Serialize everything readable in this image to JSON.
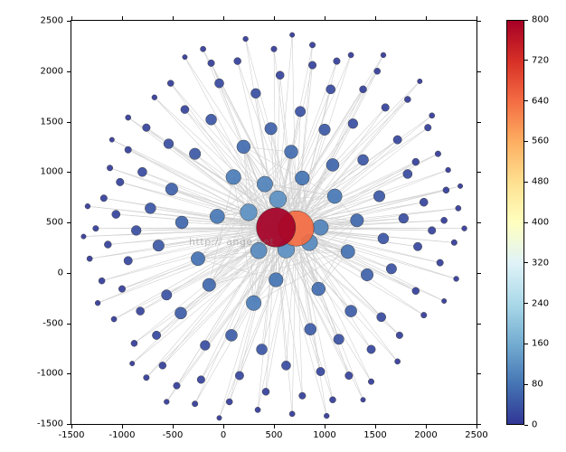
{
  "chart_data": {
    "type": "scatter",
    "title": "",
    "xlabel": "",
    "ylabel": "",
    "xlim": [
      -1500,
      2500
    ],
    "ylim": [
      -1500,
      2500
    ],
    "xticks": [
      -1500,
      -1000,
      -500,
      0,
      500,
      1000,
      1500,
      2000,
      2500
    ],
    "yticks": [
      -1500,
      -1000,
      -500,
      0,
      500,
      1000,
      1500,
      2000,
      2500
    ],
    "colorbar": {
      "ticks": [
        0,
        80,
        160,
        240,
        320,
        400,
        480,
        560,
        640,
        720,
        800
      ],
      "range": [
        0,
        800
      ],
      "cmap": "RdYlBu_r"
    },
    "description": "Network graph with edges between nodes. Node size and color scale with value (0–800). Two central hubs (~500,450 value≈800 red; ~700,450 value≈640 orange), surrounded by mid-size blue nodes and many small peripheral points.",
    "nodes": [
      {
        "x": 520,
        "y": 450,
        "v": 800
      },
      {
        "x": 720,
        "y": 440,
        "v": 640
      },
      {
        "x": 250,
        "y": 600,
        "v": 120
      },
      {
        "x": 620,
        "y": 230,
        "v": 120
      },
      {
        "x": 540,
        "y": 730,
        "v": 120
      },
      {
        "x": 350,
        "y": 220,
        "v": 110
      },
      {
        "x": 850,
        "y": 300,
        "v": 110
      },
      {
        "x": 410,
        "y": 880,
        "v": 100
      },
      {
        "x": 960,
        "y": 450,
        "v": 100
      },
      {
        "x": 300,
        "y": -300,
        "v": 90
      },
      {
        "x": 100,
        "y": 950,
        "v": 90
      },
      {
        "x": 1100,
        "y": 760,
        "v": 85
      },
      {
        "x": -60,
        "y": 560,
        "v": 85
      },
      {
        "x": 780,
        "y": 940,
        "v": 80
      },
      {
        "x": 520,
        "y": -70,
        "v": 80
      },
      {
        "x": -250,
        "y": 140,
        "v": 75
      },
      {
        "x": 1230,
        "y": 210,
        "v": 75
      },
      {
        "x": 940,
        "y": -160,
        "v": 70
      },
      {
        "x": 200,
        "y": 1250,
        "v": 70
      },
      {
        "x": 670,
        "y": 1200,
        "v": 70
      },
      {
        "x": -140,
        "y": -120,
        "v": 65
      },
      {
        "x": 1320,
        "y": 520,
        "v": 65
      },
      {
        "x": -410,
        "y": 500,
        "v": 60
      },
      {
        "x": 1080,
        "y": 1070,
        "v": 60
      },
      {
        "x": 470,
        "y": 1430,
        "v": 55
      },
      {
        "x": -510,
        "y": 830,
        "v": 55
      },
      {
        "x": 1420,
        "y": -20,
        "v": 55
      },
      {
        "x": -420,
        "y": -400,
        "v": 50
      },
      {
        "x": 1260,
        "y": -380,
        "v": 50
      },
      {
        "x": 80,
        "y": -620,
        "v": 50
      },
      {
        "x": 860,
        "y": -560,
        "v": 50
      },
      {
        "x": 1540,
        "y": 760,
        "v": 45
      },
      {
        "x": -640,
        "y": 270,
        "v": 45
      },
      {
        "x": 1000,
        "y": 1420,
        "v": 45
      },
      {
        "x": -280,
        "y": 1180,
        "v": 45
      },
      {
        "x": 1580,
        "y": 340,
        "v": 40
      },
      {
        "x": 380,
        "y": -760,
        "v": 40
      },
      {
        "x": -720,
        "y": 640,
        "v": 40
      },
      {
        "x": 1380,
        "y": 1120,
        "v": 40
      },
      {
        "x": -120,
        "y": 1520,
        "v": 40
      },
      {
        "x": 760,
        "y": 1600,
        "v": 35
      },
      {
        "x": 1660,
        "y": 40,
        "v": 35
      },
      {
        "x": -560,
        "y": -220,
        "v": 35
      },
      {
        "x": 1140,
        "y": -660,
        "v": 35
      },
      {
        "x": -180,
        "y": -720,
        "v": 30
      },
      {
        "x": 1780,
        "y": 540,
        "v": 30
      },
      {
        "x": -860,
        "y": 420,
        "v": 30
      },
      {
        "x": 320,
        "y": 1780,
        "v": 30
      },
      {
        "x": 1280,
        "y": 1480,
        "v": 30
      },
      {
        "x": -540,
        "y": 1280,
        "v": 30
      },
      {
        "x": 1560,
        "y": -440,
        "v": 25
      },
      {
        "x": 620,
        "y": -920,
        "v": 25
      },
      {
        "x": -800,
        "y": 1000,
        "v": 25
      },
      {
        "x": 1820,
        "y": 980,
        "v": 25
      },
      {
        "x": -40,
        "y": 1880,
        "v": 25
      },
      {
        "x": 1060,
        "y": 1820,
        "v": 25
      },
      {
        "x": -940,
        "y": 120,
        "v": 20
      },
      {
        "x": 1920,
        "y": 260,
        "v": 20
      },
      {
        "x": -660,
        "y": -620,
        "v": 20
      },
      {
        "x": 1460,
        "y": -760,
        "v": 20
      },
      {
        "x": 160,
        "y": -1020,
        "v": 20
      },
      {
        "x": 960,
        "y": -980,
        "v": 20
      },
      {
        "x": 1720,
        "y": 1320,
        "v": 20
      },
      {
        "x": -820,
        "y": -380,
        "v": 18
      },
      {
        "x": -380,
        "y": 1620,
        "v": 18
      },
      {
        "x": 1980,
        "y": 700,
        "v": 18
      },
      {
        "x": -1060,
        "y": 580,
        "v": 18
      },
      {
        "x": 560,
        "y": 1960,
        "v": 18
      },
      {
        "x": 1600,
        "y": 1640,
        "v": 15
      },
      {
        "x": -220,
        "y": -1060,
        "v": 15
      },
      {
        "x": 1240,
        "y": -1020,
        "v": 15
      },
      {
        "x": -1020,
        "y": 900,
        "v": 15
      },
      {
        "x": 2060,
        "y": 420,
        "v": 15
      },
      {
        "x": 880,
        "y": 2060,
        "v": 15
      },
      {
        "x": -760,
        "y": 1440,
        "v": 15
      },
      {
        "x": 1900,
        "y": -180,
        "v": 12
      },
      {
        "x": -1140,
        "y": 280,
        "v": 12
      },
      {
        "x": 420,
        "y": -1180,
        "v": 12
      },
      {
        "x": 1900,
        "y": 1100,
        "v": 12
      },
      {
        "x": -600,
        "y": -920,
        "v": 12
      },
      {
        "x": 1380,
        "y": 1820,
        "v": 12
      },
      {
        "x": 140,
        "y": 2100,
        "v": 12
      },
      {
        "x": -1000,
        "y": -160,
        "v": 10
      },
      {
        "x": 2140,
        "y": 100,
        "v": 10
      },
      {
        "x": 780,
        "y": -1220,
        "v": 10
      },
      {
        "x": -120,
        "y": 2080,
        "v": 10
      },
      {
        "x": 2020,
        "y": 1440,
        "v": 10
      },
      {
        "x": -1180,
        "y": 740,
        "v": 10
      },
      {
        "x": 1740,
        "y": -620,
        "v": 10
      },
      {
        "x": -460,
        "y": -1120,
        "v": 10
      },
      {
        "x": 1120,
        "y": 2100,
        "v": 10
      },
      {
        "x": -940,
        "y": 1220,
        "v": 10
      },
      {
        "x": 1520,
        "y": 2000,
        "v": 8
      },
      {
        "x": -1200,
        "y": -80,
        "v": 8
      },
      {
        "x": 2200,
        "y": 820,
        "v": 8
      },
      {
        "x": 60,
        "y": -1280,
        "v": 8
      },
      {
        "x": 1080,
        "y": -1260,
        "v": 8
      },
      {
        "x": -880,
        "y": -700,
        "v": 8
      },
      {
        "x": 2180,
        "y": 520,
        "v": 8
      },
      {
        "x": -520,
        "y": 1880,
        "v": 8
      },
      {
        "x": 1820,
        "y": 1720,
        "v": 8
      },
      {
        "x": -1260,
        "y": 440,
        "v": 6
      },
      {
        "x": 2280,
        "y": 300,
        "v": 6
      },
      {
        "x": 500,
        "y": 2220,
        "v": 6
      },
      {
        "x": -280,
        "y": -1300,
        "v": 6
      },
      {
        "x": 1460,
        "y": -1080,
        "v": 6
      },
      {
        "x": -1120,
        "y": 1040,
        "v": 6
      },
      {
        "x": 2120,
        "y": 1180,
        "v": 6
      },
      {
        "x": 880,
        "y": 2260,
        "v": 6
      },
      {
        "x": -760,
        "y": -1040,
        "v": 6
      },
      {
        "x": 1980,
        "y": -420,
        "v": 6
      },
      {
        "x": 340,
        "y": -1360,
        "v": 5
      },
      {
        "x": -1320,
        "y": 140,
        "v": 5
      },
      {
        "x": 2320,
        "y": 640,
        "v": 5
      },
      {
        "x": -200,
        "y": 2220,
        "v": 5
      },
      {
        "x": 1720,
        "y": -880,
        "v": 5
      },
      {
        "x": 1260,
        "y": 2160,
        "v": 5
      },
      {
        "x": -1080,
        "y": -460,
        "v": 5
      },
      {
        "x": 2060,
        "y": 1560,
        "v": 5
      },
      {
        "x": -940,
        "y": 1540,
        "v": 5
      },
      {
        "x": 680,
        "y": -1400,
        "v": 5
      },
      {
        "x": 2220,
        "y": 1020,
        "v": 4
      },
      {
        "x": -1340,
        "y": 660,
        "v": 4
      },
      {
        "x": 1020,
        "y": -1420,
        "v": 4
      },
      {
        "x": 220,
        "y": 2320,
        "v": 4
      },
      {
        "x": -560,
        "y": -1280,
        "v": 4
      },
      {
        "x": 2300,
        "y": -60,
        "v": 4
      },
      {
        "x": 1580,
        "y": 2160,
        "v": 4
      },
      {
        "x": -1240,
        "y": -300,
        "v": 4
      },
      {
        "x": 2380,
        "y": 440,
        "v": 4
      },
      {
        "x": -680,
        "y": 1740,
        "v": 4
      },
      {
        "x": 680,
        "y": 2360,
        "v": 3
      },
      {
        "x": -40,
        "y": -1440,
        "v": 3
      },
      {
        "x": 1940,
        "y": 1900,
        "v": 3
      },
      {
        "x": -1380,
        "y": 360,
        "v": 3
      },
      {
        "x": 2340,
        "y": 860,
        "v": 3
      },
      {
        "x": 1380,
        "y": -1260,
        "v": 3
      },
      {
        "x": -1100,
        "y": 1320,
        "v": 3
      },
      {
        "x": 2180,
        "y": -280,
        "v": 3
      },
      {
        "x": -380,
        "y": 2140,
        "v": 3
      },
      {
        "x": -900,
        "y": -900,
        "v": 3
      }
    ],
    "hub_indices": [
      0,
      1
    ],
    "watermark": "http://                  ange.net"
  }
}
